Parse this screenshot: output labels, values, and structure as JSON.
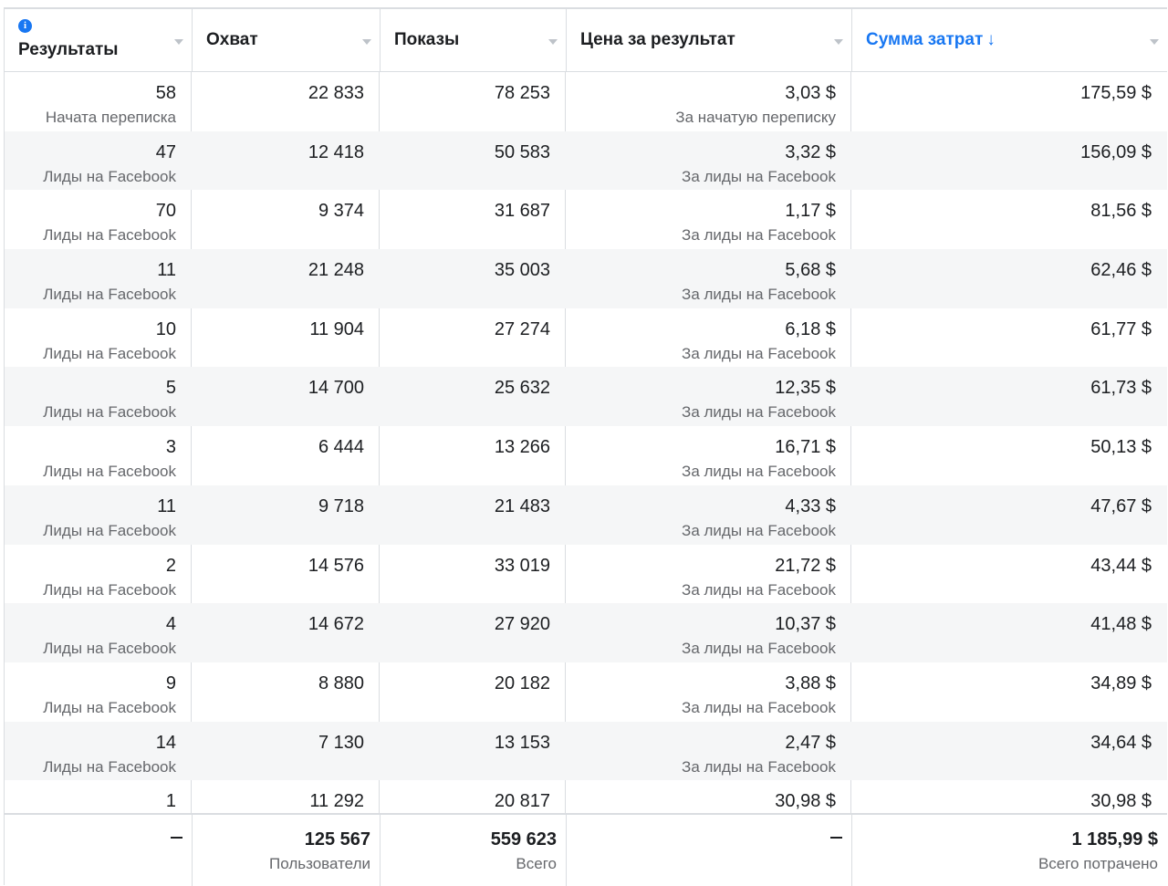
{
  "headers": {
    "results": "Результаты",
    "reach": "Охват",
    "impressions": "Показы",
    "cost_per_result": "Цена за результат",
    "amount_spent": "Сумма затрат",
    "sort_arrow": "↓",
    "info_glyph": "i"
  },
  "rows": [
    {
      "results": "58",
      "results_type": "Начата переписка",
      "reach": "22 833",
      "impressions": "78 253",
      "cost": "3,03 $",
      "cost_type": "За начатую переписку",
      "spent": "175,59 $"
    },
    {
      "results": "47",
      "results_type": "Лиды на Facebook",
      "reach": "12 418",
      "impressions": "50 583",
      "cost": "3,32 $",
      "cost_type": "За лиды на Facebook",
      "spent": "156,09 $"
    },
    {
      "results": "70",
      "results_type": "Лиды на Facebook",
      "reach": "9 374",
      "impressions": "31 687",
      "cost": "1,17 $",
      "cost_type": "За лиды на Facebook",
      "spent": "81,56 $"
    },
    {
      "results": "11",
      "results_type": "Лиды на Facebook",
      "reach": "21 248",
      "impressions": "35 003",
      "cost": "5,68 $",
      "cost_type": "За лиды на Facebook",
      "spent": "62,46 $"
    },
    {
      "results": "10",
      "results_type": "Лиды на Facebook",
      "reach": "11 904",
      "impressions": "27 274",
      "cost": "6,18 $",
      "cost_type": "За лиды на Facebook",
      "spent": "61,77 $"
    },
    {
      "results": "5",
      "results_type": "Лиды на Facebook",
      "reach": "14 700",
      "impressions": "25 632",
      "cost": "12,35 $",
      "cost_type": "За лиды на Facebook",
      "spent": "61,73 $"
    },
    {
      "results": "3",
      "results_type": "Лиды на Facebook",
      "reach": "6 444",
      "impressions": "13 266",
      "cost": "16,71 $",
      "cost_type": "За лиды на Facebook",
      "spent": "50,13 $"
    },
    {
      "results": "11",
      "results_type": "Лиды на Facebook",
      "reach": "9 718",
      "impressions": "21 483",
      "cost": "4,33 $",
      "cost_type": "За лиды на Facebook",
      "spent": "47,67 $"
    },
    {
      "results": "2",
      "results_type": "Лиды на Facebook",
      "reach": "14 576",
      "impressions": "33 019",
      "cost": "21,72 $",
      "cost_type": "За лиды на Facebook",
      "spent": "43,44 $"
    },
    {
      "results": "4",
      "results_type": "Лиды на Facebook",
      "reach": "14 672",
      "impressions": "27 920",
      "cost": "10,37 $",
      "cost_type": "За лиды на Facebook",
      "spent": "41,48 $"
    },
    {
      "results": "9",
      "results_type": "Лиды на Facebook",
      "reach": "8 880",
      "impressions": "20 182",
      "cost": "3,88 $",
      "cost_type": "За лиды на Facebook",
      "spent": "34,89 $"
    },
    {
      "results": "14",
      "results_type": "Лиды на Facebook",
      "reach": "7 130",
      "impressions": "13 153",
      "cost": "2,47 $",
      "cost_type": "За лиды на Facebook",
      "spent": "34,64 $"
    },
    {
      "results": "1",
      "results_type": "",
      "reach": "11 292",
      "impressions": "20 817",
      "cost": "30,98 $",
      "cost_type": "",
      "spent": "30,98 $"
    }
  ],
  "totals": {
    "reach": "125 567",
    "reach_label": "Пользователи",
    "impressions": "559 623",
    "impressions_label": "Всего",
    "spent": "1 185,99 $",
    "spent_label": "Всего потрачено"
  },
  "colors": {
    "accent": "#1877f2",
    "border": "#dadde1",
    "alt_row": "#f5f6f7",
    "secondary_text": "#65676b"
  },
  "icons": {
    "info": "info-icon",
    "dropdown": "chevron-down-icon",
    "sort": "sort-down-arrow"
  }
}
